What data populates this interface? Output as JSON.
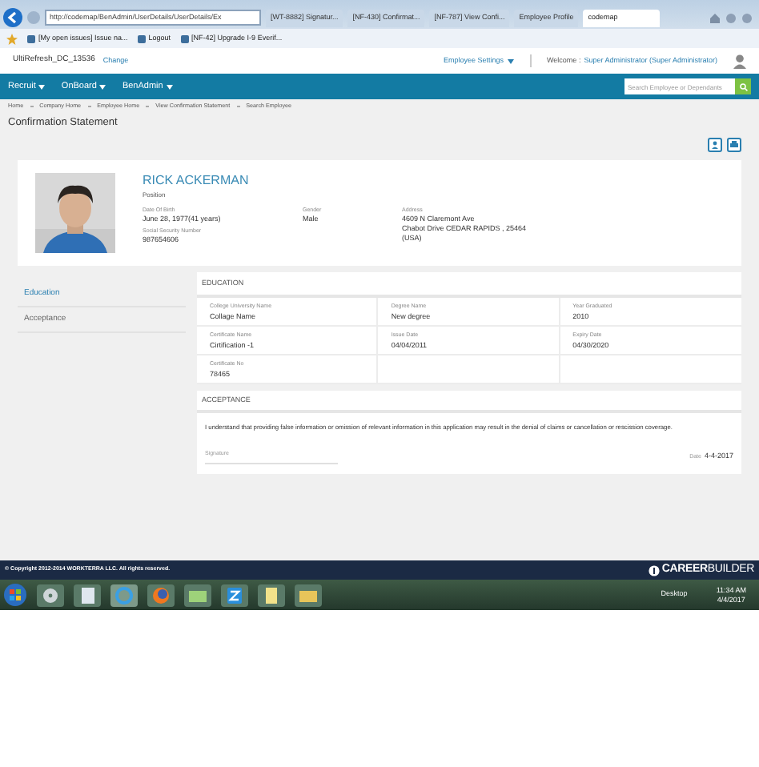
{
  "browser": {
    "address": "http://codemap/BenAdmin/UserDetails/UserDetails/Ex",
    "tabs": [
      {
        "label": "[WT-8882] Signatur...",
        "selected": false
      },
      {
        "label": "[NF-430] Confirmat...",
        "selected": false
      },
      {
        "label": "[NF-787] View Confi...",
        "selected": false
      },
      {
        "label": "Employee Profile",
        "selected": false
      },
      {
        "label": "codemap",
        "selected": true
      }
    ],
    "favorites": [
      "[My open issues] Issue na...",
      "Logout",
      "[NF-42] Upgrade I-9 Everif..."
    ]
  },
  "header": {
    "company": "UltiRefresh_DC_13536",
    "change_link": "Change",
    "settings": "Employee Settings",
    "welcome": "Welcome :",
    "user": "Super Administrator (Super Administrator)"
  },
  "nav": {
    "items": [
      "Recruit",
      "OnBoard",
      "BenAdmin"
    ],
    "search": {
      "placeholder": "Search Employee or Dependants"
    }
  },
  "breadcrumb": [
    "Home",
    "Company Home",
    "Employee Home",
    "View Confirmation Statement",
    "Search Employee"
  ],
  "page_title": "Confirmation Statement",
  "profile": {
    "name": "RICK ACKERMAN",
    "position": "Position",
    "columns": [
      [
        {
          "label": "Date Of Birth",
          "lines": [
            "June 28, 1977(41 years)"
          ]
        },
        {
          "label": "Social Security Number",
          "lines": [
            "987654606"
          ]
        }
      ],
      [
        {
          "label": "Gender",
          "lines": [
            "Male"
          ]
        }
      ],
      [
        {
          "label": "Address",
          "lines": [
            "4609 N Claremont Ave",
            "Chabot Drive CEDAR RAPIDS , 25464",
            "(USA)"
          ]
        }
      ]
    ]
  },
  "side_nav": [
    {
      "label": "Education",
      "selected": true
    },
    {
      "label": "Acceptance",
      "selected": false
    }
  ],
  "education": {
    "heading": "EDUCATION",
    "fields": [
      {
        "label": "College University Name",
        "value": "Collage Name"
      },
      {
        "label": "Degree Name",
        "value": "New degree"
      },
      {
        "label": "Year Graduated",
        "value": "2010"
      },
      {
        "label": "Certificate Name",
        "value": "Cirtification -1"
      },
      {
        "label": "Issue Date",
        "value": "04/04/2011"
      },
      {
        "label": "Expiry Date",
        "value": "04/30/2020"
      },
      {
        "label": "Certificate No",
        "value": "78465"
      }
    ]
  },
  "acceptance": {
    "heading": "ACCEPTANCE",
    "statement": "I understand that providing false information or omission of relevant information in this application may result in the denial of claims or cancellation or rescission coverage.",
    "signature_label": "Signature",
    "date_label": "Date",
    "date": "4-4-2017"
  },
  "footer": {
    "copyright": "© Copyright 2012-2014 WORKTERRA LLC. All rights reserved.",
    "logo": "**CAREER**BUILDER"
  },
  "taskbar": {
    "desktop": "Desktop",
    "time": "11:34 AM",
    "date": "4/4/2017"
  }
}
